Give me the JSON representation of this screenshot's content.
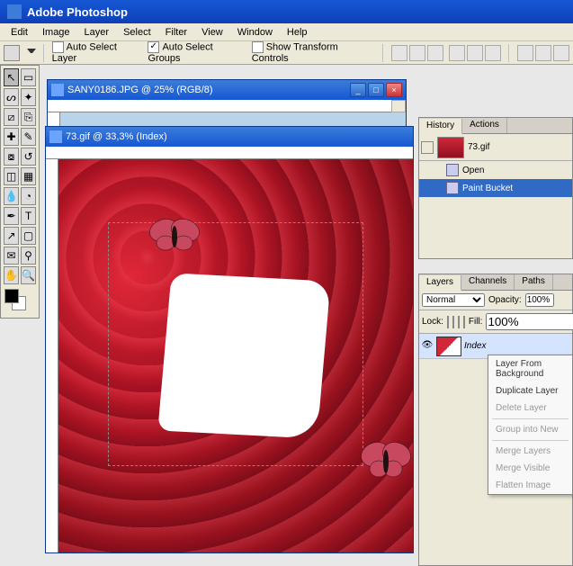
{
  "app_title": "Adobe Photoshop",
  "menu": [
    "Edit",
    "Image",
    "Layer",
    "Select",
    "Filter",
    "View",
    "Window",
    "Help"
  ],
  "options": {
    "auto_select_layer": "Auto Select Layer",
    "auto_select_groups": "Auto Select Groups",
    "show_transform": "Show Transform Controls"
  },
  "tools": [
    [
      "move",
      "marquee"
    ],
    [
      "lasso",
      "wand"
    ],
    [
      "crop",
      "slice"
    ],
    [
      "heal",
      "brush"
    ],
    [
      "stamp",
      "history-brush"
    ],
    [
      "eraser",
      "gradient"
    ],
    [
      "blur",
      "dodge"
    ],
    [
      "pen",
      "type"
    ],
    [
      "path",
      "shape"
    ],
    [
      "notes",
      "eyedrop"
    ],
    [
      "hand",
      "zoom"
    ]
  ],
  "tool_glyphs": {
    "move": "↖",
    "marquee": "▭",
    "lasso": "ᔕ",
    "wand": "✦",
    "crop": "⧄",
    "slice": "⎘",
    "heal": "✚",
    "brush": "✎",
    "stamp": "⧇",
    "history-brush": "↺",
    "eraser": "◫",
    "gradient": "▦",
    "blur": "💧",
    "dodge": "◔",
    "pen": "✒",
    "type": "T",
    "path": "↗",
    "shape": "▢",
    "notes": "✉",
    "eyedrop": "⚲",
    "hand": "✋",
    "zoom": "🔍"
  },
  "documents": {
    "d1": {
      "title": "SANY0186.JPG @ 25% (RGB/8)"
    },
    "d2": {
      "title": "73.gif @ 33,3% (Index)"
    }
  },
  "history": {
    "tabs": [
      "History",
      "Actions"
    ],
    "source": "73.gif",
    "items": [
      {
        "label": "Open",
        "sel": false
      },
      {
        "label": "Paint Bucket",
        "sel": true
      }
    ]
  },
  "layers": {
    "tabs": [
      "Layers",
      "Channels",
      "Paths"
    ],
    "blend": "Normal",
    "opacity_label": "Opacity:",
    "opacity": "100%",
    "lock_label": "Lock:",
    "fill_label": "Fill:",
    "fill": "100%",
    "items": [
      {
        "name": "Index",
        "visible": true
      }
    ]
  },
  "context_menu": [
    {
      "label": "Layer From Background",
      "dis": false
    },
    {
      "label": "Duplicate Layer",
      "dis": false
    },
    {
      "label": "Delete Layer",
      "dis": true
    },
    {
      "sep": true
    },
    {
      "label": "Group into New",
      "dis": true
    },
    {
      "sep": true
    },
    {
      "label": "Merge Layers",
      "dis": true
    },
    {
      "label": "Merge Visible",
      "dis": true
    },
    {
      "label": "Flatten Image",
      "dis": true
    }
  ]
}
